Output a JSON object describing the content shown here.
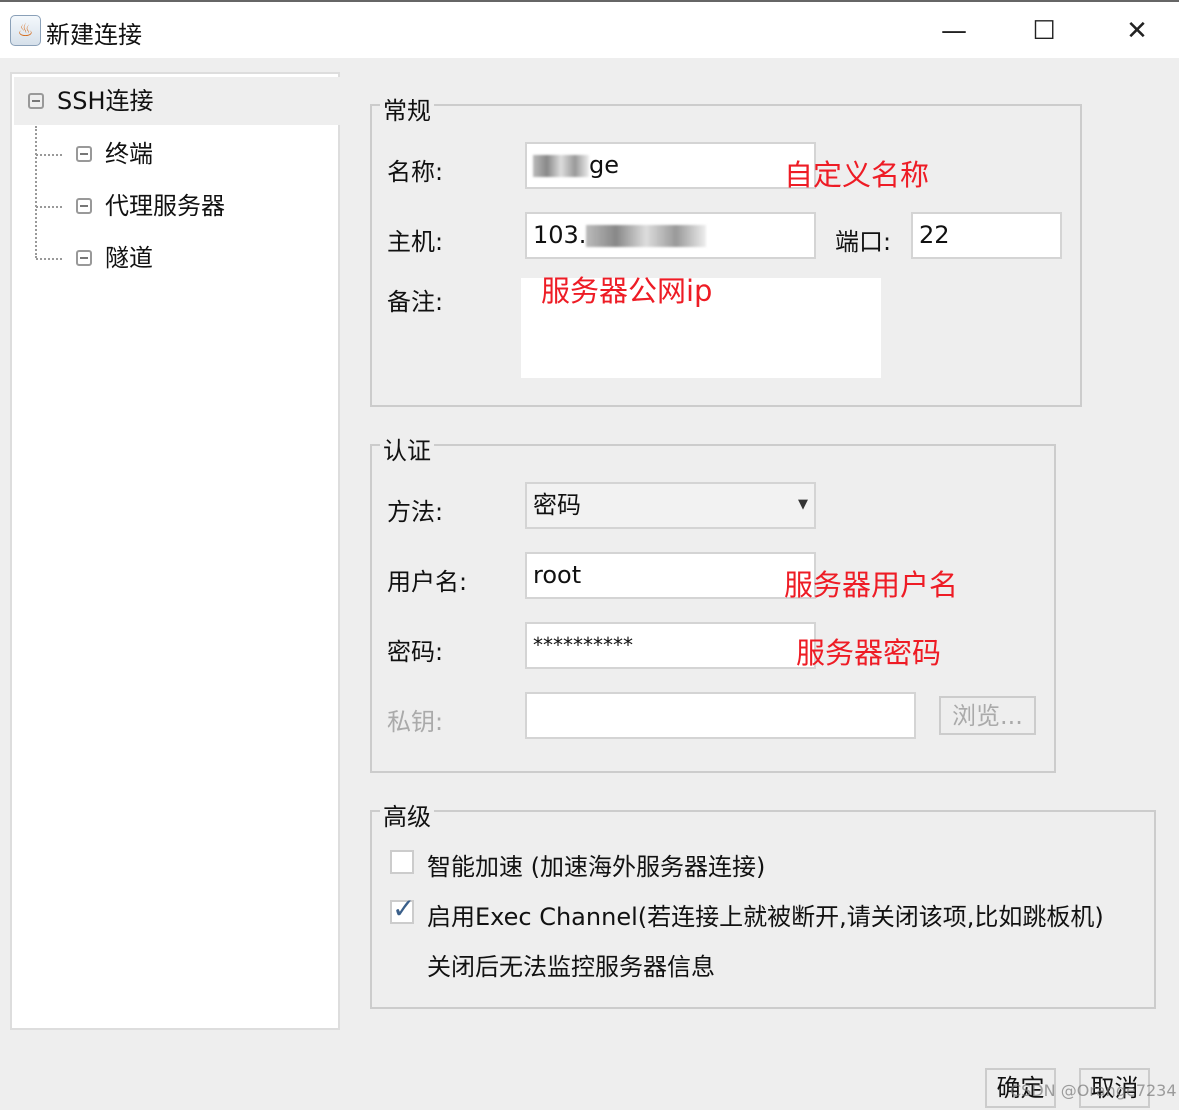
{
  "window": {
    "title": "新建连接",
    "minimize": "—",
    "maximize": "☐",
    "close": "✕"
  },
  "tree": {
    "root": "SSH连接",
    "children": [
      "终端",
      "代理服务器",
      "隧道"
    ]
  },
  "general": {
    "legend": "常规",
    "name_label": "名称:",
    "name_value": "ge",
    "name_note": "自定义名称",
    "host_label": "主机:",
    "host_value": "103.",
    "host_note": "服务器公网ip",
    "port_label": "端口:",
    "port_value": "22",
    "remark_label": "备注:"
  },
  "auth": {
    "legend": "认证",
    "method_label": "方法:",
    "method_value": "密码",
    "user_label": "用户名:",
    "user_value": "root",
    "user_note": "服务器用户名",
    "password_label": "密码:",
    "password_value": "**********",
    "password_note": "服务器密码",
    "key_label": "私钥:",
    "browse": "浏览..."
  },
  "advanced": {
    "legend": "高级",
    "accel": {
      "label": "智能加速 (加速海外服务器连接)",
      "checked": false
    },
    "exec": {
      "label": "启用Exec Channel(若连接上就被断开,请关闭该项,比如跳板机)",
      "checked": true
    },
    "exec_note": "关闭后无法监控服务器信息"
  },
  "footer": {
    "ok": "确定",
    "cancel": "取消",
    "watermark": "CSDN @Orange7234"
  }
}
